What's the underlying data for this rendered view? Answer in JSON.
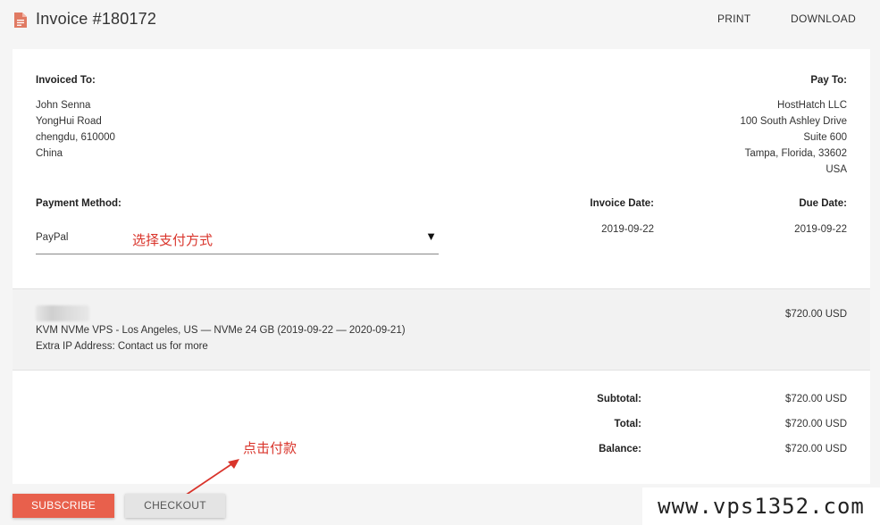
{
  "header": {
    "title": "Invoice #180172",
    "print_label": "PRINT",
    "download_label": "DOWNLOAD"
  },
  "invoiced_to": {
    "label": "Invoiced To:",
    "lines": [
      "John Senna",
      "YongHui Road",
      "chengdu, 610000",
      "China"
    ]
  },
  "pay_to": {
    "label": "Pay To:",
    "lines": [
      "HostHatch LLC",
      "100 South Ashley Drive",
      "Suite 600",
      "Tampa, Florida, 33602",
      "USA"
    ]
  },
  "payment": {
    "label": "Payment Method:",
    "selected": "PayPal",
    "annotation": "选择支付方式"
  },
  "invoice_date": {
    "label": "Invoice Date:",
    "value": "2019-09-22"
  },
  "due_date": {
    "label": "Due Date:",
    "value": "2019-09-22"
  },
  "item": {
    "description": "KVM NVMe VPS - Los Angeles, US — NVMe 24 GB (2019-09-22 — 2020-09-21)",
    "extra": "Extra IP Address: Contact us for more",
    "amount": "$720.00 USD"
  },
  "totals": {
    "subtotal_label": "Subtotal:",
    "subtotal": "$720.00 USD",
    "total_label": "Total:",
    "total": "$720.00 USD",
    "balance_label": "Balance:",
    "balance": "$720.00 USD"
  },
  "buttons": {
    "subscribe": "SUBSCRIBE",
    "checkout": "CHECKOUT"
  },
  "checkout_annotation": "点击付款",
  "watermark": "www.vps1352.com",
  "colors": {
    "accent": "#e8604c",
    "annotation_red": "#d9342b",
    "icon": "#e07a63"
  }
}
